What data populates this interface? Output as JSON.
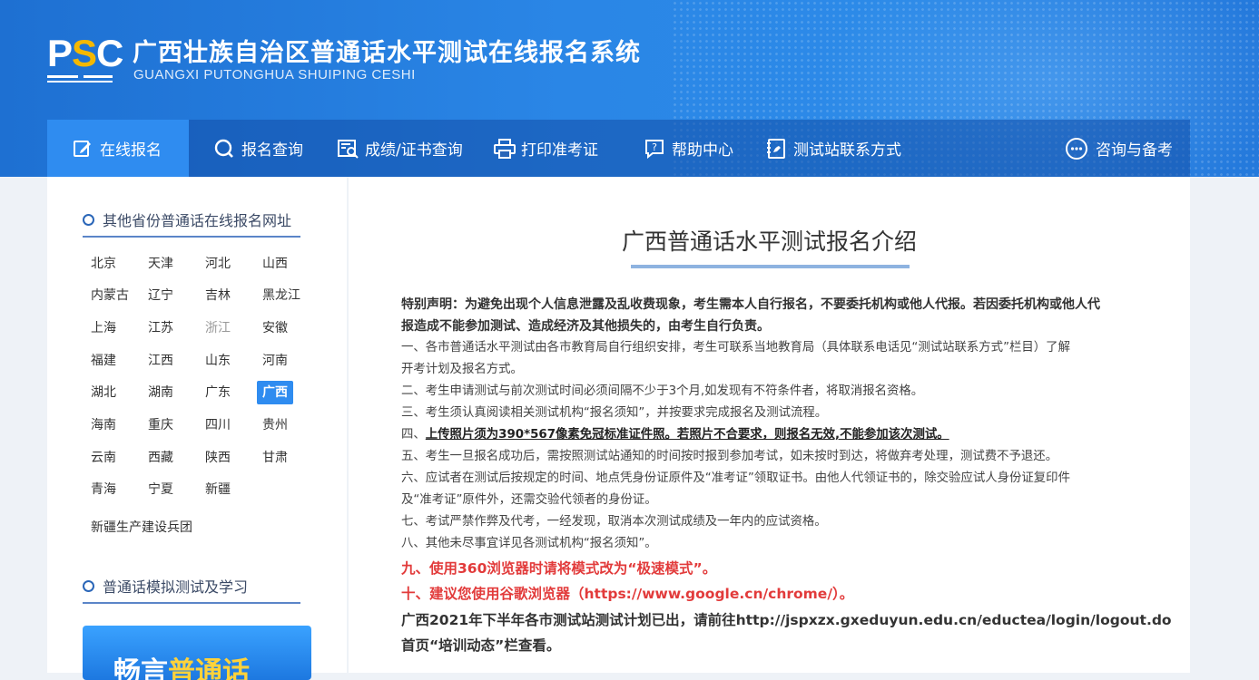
{
  "header": {
    "logo_text_p": "P",
    "logo_text_s": "S",
    "logo_text_c": "C",
    "title": "广西壮族自治区普通话水平测试在线报名系统",
    "subtitle": "GUANGXI PUTONGHUA SHUIPING CESHI"
  },
  "nav": {
    "items": [
      {
        "label": "在线报名",
        "icon": "edit-icon"
      },
      {
        "label": "报名查询",
        "icon": "search-icon"
      },
      {
        "label": "成绩/证书查询",
        "icon": "certificate-search-icon"
      },
      {
        "label": "打印准考证",
        "icon": "printer-icon"
      },
      {
        "label": "帮助中心",
        "icon": "help-icon"
      },
      {
        "label": "测试站联系方式",
        "icon": "contact-icon"
      },
      {
        "label": "咨询与备考",
        "icon": "chat-icon"
      }
    ],
    "active": "在线报名",
    "accent": "#2f8cf0"
  },
  "sidebar": {
    "section1_title": "其他省份普通话在线报名网址",
    "provinces": [
      "北京",
      "天津",
      "河北",
      "山西",
      "内蒙古",
      "辽宁",
      "吉林",
      "黑龙江",
      "上海",
      "江苏",
      "浙江",
      "安徽",
      "福建",
      "江西",
      "山东",
      "河南",
      "湖北",
      "湖南",
      "广东",
      "广西",
      "海南",
      "重庆",
      "四川",
      "贵州",
      "云南",
      "西藏",
      "陕西",
      "甘肃",
      "青海",
      "宁夏",
      "新疆"
    ],
    "bingtuan": "新疆生产建设兵团",
    "active_province": "广西",
    "section2_title": "普通话模拟测试及学习",
    "promo_a": "畅言",
    "promo_b": "普通话"
  },
  "main": {
    "title": "广西普通话水平测试报名介绍",
    "notice_bold_1": "特别声明：为避免出现个人信息泄露及乱收费现象，考生需本人自行报名，不要委托机构或他人代报。若因委托机构或他人代",
    "notice_bold_2": "报造成不能参加测试、造成经济及其他损失的，由考生自行负责。",
    "item1_a": "一、各市普通话水平测试由各市教育局自行组织安排，考生可联系当地教育局（具体联系电话见“测试站联系方式”栏目）了解",
    "item1_b": "开考计划及报名方式。",
    "item2": "二、考生申请测试与前次测试时间必须间隔不少于3个月,如发现有不符条件者，将取消报名资格。",
    "item3": "三、考生须认真阅读相关测试机构“报名须知”，并按要求完成报名及测试流程。",
    "item4_prefix": "四、",
    "item4_text": "上传照片须为390*567像素免冠标准证件照。若照片不合要求，则报名无效,不能参加该次测试。",
    "item5": "五、考生一旦报名成功后，需按照测试站通知的时间按时报到参加考试，如未按时到达，将做弃考处理，测试费不予退还。",
    "item6_a": "六、应试者在测试后按规定的时间、地点凭身份证原件及“准考证”领取证书。由他人代领证书的，除交验应试人身份证复印件",
    "item6_b": "及“准考证”原件外，还需交验代领者的身份证。",
    "item7": "七、考试严禁作弊及代考，一经发现，取消本次测试成绩及一年内的应试资格。",
    "item8": "八、其他未尽事宜详见各测试机构“报名须知”。",
    "item9": "九、使用360浏览器时请将模式改为“极速模式”。",
    "item10": "十、建议您使用谷歌浏览器（https://www.google.cn/chrome/）。",
    "plan_a": "广西2021年下半年各市测试站测试计划已出，请前往http://jspxzx.gxeduyun.edu.cn/eductea/login/logout.do",
    "plan_b": "首页“培训动态”栏查看。",
    "red": "#e23b3b"
  }
}
